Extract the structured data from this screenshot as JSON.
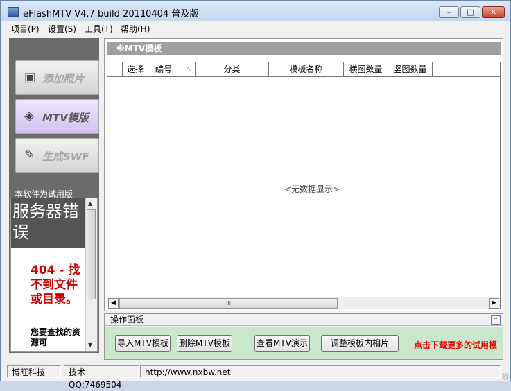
{
  "window": {
    "title": "eFlashMTV V4.7 build 20110404 普及版",
    "controls": {
      "minimize": "–",
      "maximize": "□",
      "close": "✕"
    }
  },
  "menu": [
    "项目(P)",
    "设置(S)",
    "工具(T)",
    "帮助(H)"
  ],
  "sidebar": {
    "nav": [
      {
        "label": "添加照片",
        "icon": "photo-icon"
      },
      {
        "label": "MTV模版",
        "icon": "template-icon"
      },
      {
        "label": "生成SWF",
        "icon": "swf-icon"
      }
    ],
    "trial_text": "本软件为试用版",
    "web_error": {
      "heading": "服务器错误",
      "code_text": "404 - 找不到文件或目录。",
      "sub_text": "您要查找的资源可"
    }
  },
  "template_panel": {
    "header": "※MTV模板",
    "columns": [
      "",
      "选择",
      "编号",
      "分类",
      "模板名称",
      "横图数量",
      "竖图数量"
    ],
    "sort_indicator": "△",
    "empty_text": "<无数据显示>",
    "scroll_thumb": "III"
  },
  "ops_panel": {
    "header": "操作面板",
    "collapse_glyph": "⌃",
    "buttons": [
      "导入MTV模板",
      "删除MTV模板",
      "查看MTV演示",
      "调整模板内相片"
    ],
    "promo": "点击下载更多的试用模"
  },
  "statusbar": [
    "博旺科技",
    "技术QQ:7469504",
    "http://www.nxbw.net"
  ],
  "colors": {
    "ops_background": "#c9e7cc",
    "promo_text": "#e00000",
    "error_text": "#cc0000"
  }
}
